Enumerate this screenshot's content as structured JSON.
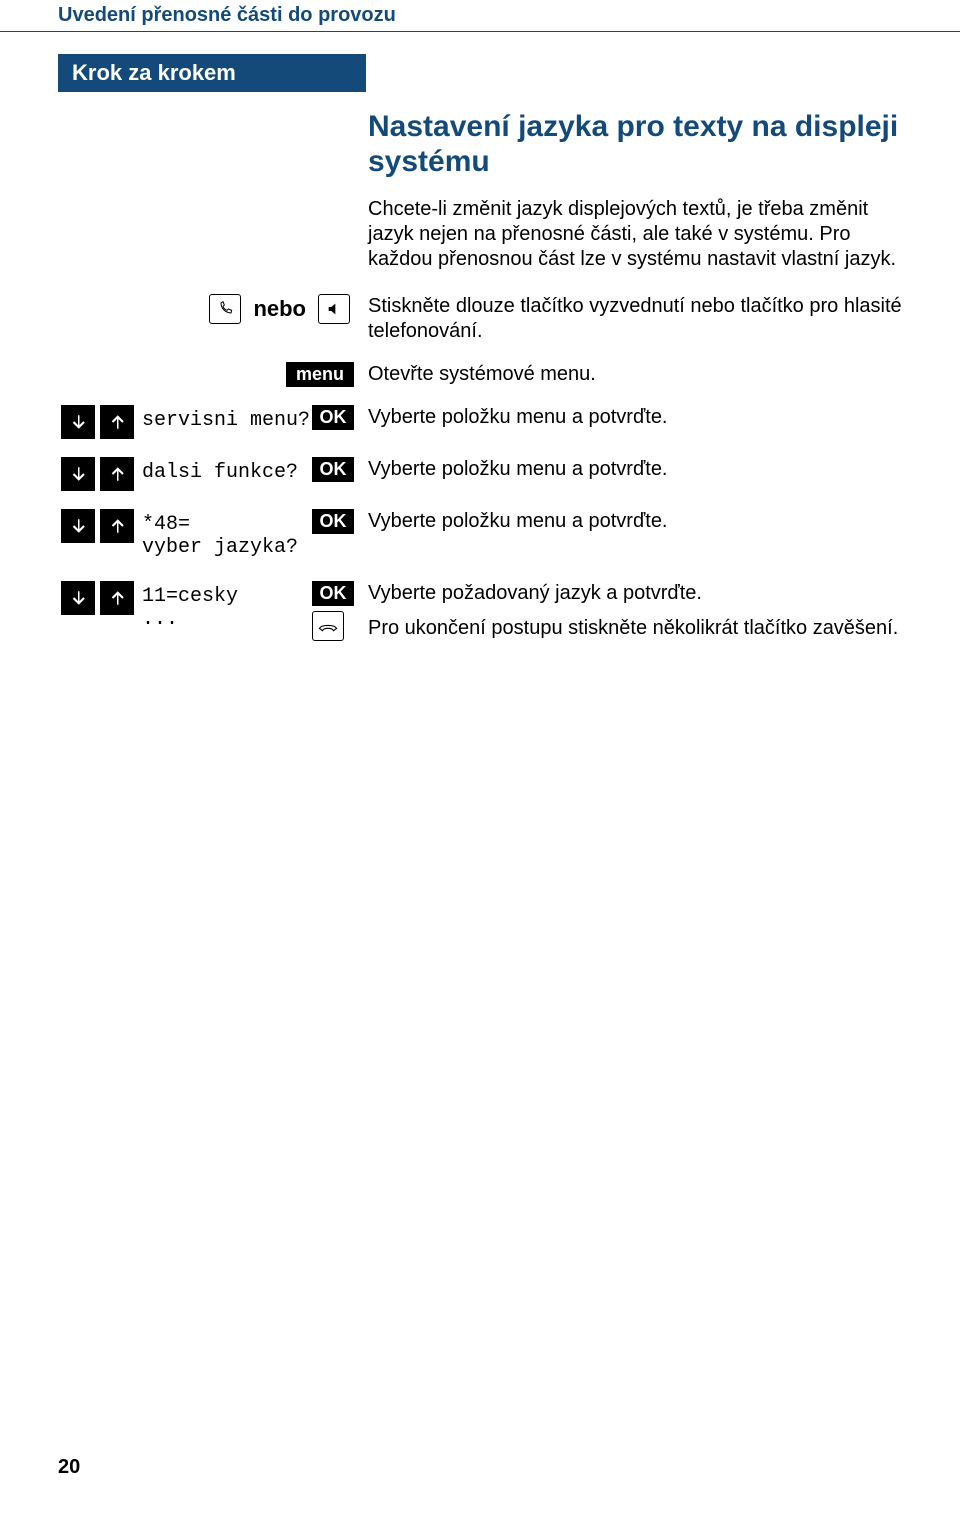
{
  "header": "Uvedení přenosné části do provozu",
  "step_box": "Krok za krokem",
  "section_title": "Nastavení jazyka pro texty na displeji systému",
  "intro": "Chcete-li změnit jazyk displejových textů, je třeba změnit jazyk nejen na přenosné části, ale také v systému. Pro každou přenosnou část lze v systému nastavit vlastní jazyk.",
  "rows": {
    "nebo": {
      "word": "nebo",
      "desc": "Stiskněte dlouze tlačítko vyzvednutí nebo tlačítko pro hlasité telefonování."
    },
    "menu": {
      "label": "menu",
      "desc": "Otevřte systémové menu."
    },
    "r1": {
      "text": "servisni menu?",
      "ok": "OK",
      "desc": "Vyberte položku menu a potvrďte."
    },
    "r2": {
      "text": "dalsi funkce?",
      "ok": "OK",
      "desc": "Vyberte položku menu a potvrďte."
    },
    "r3": {
      "text1": "*48=",
      "text2": "vyber jazyka?",
      "ok": "OK",
      "desc": "Vyberte položku menu a potvrďte."
    },
    "r4": {
      "text1": "11=cesky",
      "text2": "...",
      "ok": "OK",
      "desc1": "Vyberte požadovaný jazyk a potvrďte.",
      "desc2": "Pro ukončení postupu stiskněte několikrát tlačítko zavěšení."
    }
  },
  "page_number": "20"
}
